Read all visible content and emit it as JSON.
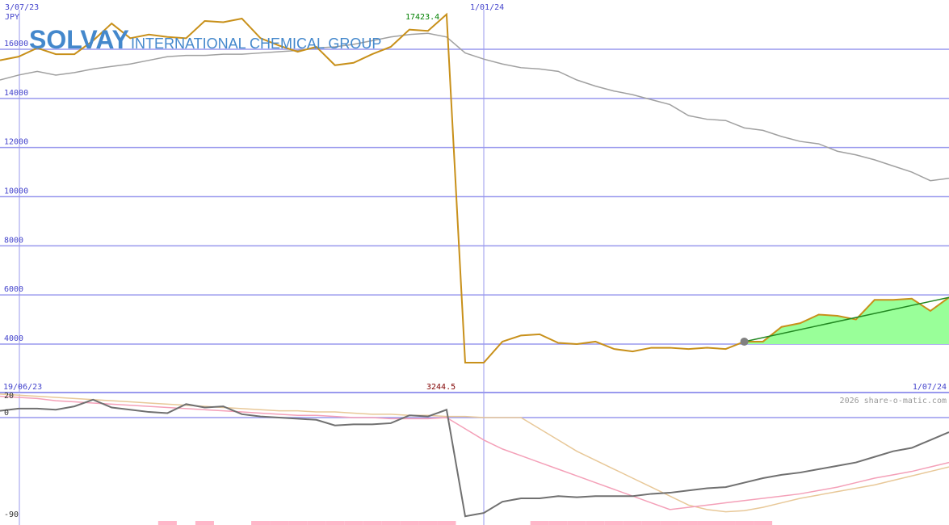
{
  "title": {
    "brand": "SOLVAY",
    "subtitle": "INTERNATIONAL CHEMICAL GROUP"
  },
  "copyright": "2026 share-o-matic.com",
  "colors": {
    "price": "#c8901a",
    "moving_avg": "#a0a0a0",
    "grid": "#9999ee",
    "axis_text": "#4444cc",
    "trend": "#228822",
    "trend_fill": "#99ff99",
    "marker": "#808080",
    "high_label": "#008000",
    "low_label": "#800000",
    "osc_main": "#707070",
    "osc_pink": "#f4a0b8",
    "osc_tan": "#e8c898",
    "volume": "#ffb6c8",
    "brand": "#4488cc"
  },
  "chart_data": [
    {
      "type": "line",
      "name": "price-panel",
      "unit_label": "JPY",
      "date_labels": [
        "3/07/23",
        "1/01/24"
      ],
      "ylim": [
        3000,
        17500
      ],
      "yticks": [
        4000,
        6000,
        8000,
        10000,
        12000,
        14000,
        16000
      ],
      "high_label": "17423.4",
      "low_label": "3244.5",
      "x": [
        0,
        1,
        2,
        3,
        4,
        5,
        6,
        7,
        8,
        9,
        10,
        11,
        12,
        13,
        14,
        15,
        16,
        17,
        18,
        19,
        20,
        21,
        22,
        23,
        24,
        25,
        26,
        27,
        28,
        29,
        30,
        31,
        32,
        33,
        34,
        35,
        36,
        37,
        38,
        39,
        40,
        41,
        42,
        43,
        44,
        45,
        46,
        47,
        48,
        49,
        50,
        51
      ],
      "series": [
        {
          "values": [
            15550,
            15700,
            16050,
            15800,
            15800,
            16350,
            17050,
            16450,
            16600,
            16500,
            16450,
            17150,
            17100,
            17250,
            16450,
            16150,
            15900,
            16100,
            15350,
            15450,
            15800,
            16100,
            16800,
            16750,
            17423,
            3244,
            3244,
            4100,
            4350,
            4400,
            4050,
            4000,
            4100,
            3800,
            3700,
            3850,
            3850,
            3800,
            3850,
            3800,
            4100,
            4100,
            4700,
            4850,
            5200,
            5150,
            5000,
            5800,
            5800,
            5850,
            5350,
            5900
          ]
        },
        {
          "values": [
            14750,
            14950,
            15100,
            14950,
            15050,
            15200,
            15300,
            15400,
            15550,
            15700,
            15750,
            15750,
            15800,
            15800,
            15850,
            15900,
            15950,
            16050,
            16100,
            16200,
            16350,
            16500,
            16600,
            16650,
            16500,
            15850,
            15600,
            15400,
            15250,
            15200,
            15100,
            14750,
            14500,
            14300,
            14150,
            13950,
            13750,
            13300,
            13150,
            13100,
            12800,
            12700,
            12450,
            12250,
            12150,
            11850,
            11700,
            11500,
            11250,
            11000,
            10650,
            10750
          ]
        }
      ],
      "trend": {
        "x": [
          40,
          51
        ],
        "y": [
          4100,
          5900
        ]
      }
    },
    {
      "type": "line",
      "name": "oscillator-panel",
      "date_labels": [
        "19/06/23",
        "1/07/24"
      ],
      "ylim": [
        -90,
        22
      ],
      "yticks": [
        20,
        0,
        -90
      ],
      "x": [
        0,
        1,
        2,
        3,
        4,
        5,
        6,
        7,
        8,
        9,
        10,
        11,
        12,
        13,
        14,
        15,
        16,
        17,
        18,
        19,
        20,
        21,
        22,
        23,
        24,
        25,
        26,
        27,
        28,
        29,
        30,
        31,
        32,
        33,
        34,
        35,
        36,
        37,
        38,
        39,
        40,
        41,
        42,
        43,
        44,
        45,
        46,
        47,
        48,
        49,
        50,
        51
      ],
      "series": [
        {
          "values": [
            6,
            8,
            8,
            7,
            10,
            16,
            9,
            7,
            5,
            4,
            12,
            9,
            10,
            3,
            1,
            0,
            -1,
            -2,
            -7,
            -6,
            -6,
            -5,
            2,
            1,
            7,
            -88,
            -85,
            -75,
            -72,
            -72,
            -70,
            -71,
            -70,
            -70,
            -70,
            -68,
            -67,
            -65,
            -63,
            -62,
            -58,
            -54,
            -51,
            -49,
            -46,
            -43,
            -40,
            -35,
            -30,
            -27,
            -20,
            -13
          ]
        },
        {
          "values": [
            19,
            18,
            17,
            15,
            14,
            13,
            12,
            11,
            10,
            9,
            8,
            7,
            6,
            5,
            4,
            3,
            2,
            2,
            1,
            0,
            0,
            -1,
            -1,
            -1,
            0,
            -10,
            -20,
            -28,
            -34,
            -40,
            -46,
            -52,
            -58,
            -64,
            -70,
            -76,
            -82,
            -80,
            -78,
            -76,
            -74,
            -72,
            -70,
            -68,
            -65,
            -62,
            -58,
            -54,
            -51,
            -48,
            -44,
            -40
          ]
        },
        {
          "values": [
            21,
            20,
            19,
            18,
            17,
            16,
            15,
            14,
            13,
            12,
            11,
            10,
            9,
            8,
            7,
            6,
            6,
            5,
            5,
            4,
            3,
            3,
            2,
            2,
            1,
            1,
            0,
            0,
            0,
            -10,
            -20,
            -30,
            -38,
            -46,
            -54,
            -62,
            -70,
            -78,
            -82,
            -84,
            -83,
            -80,
            -76,
            -72,
            -69,
            -66,
            -63,
            -60,
            -56,
            -52,
            -48,
            -44
          ]
        }
      ],
      "volume": [
        0,
        0,
        0,
        0,
        0,
        0,
        0,
        0,
        0,
        1,
        0,
        1,
        0,
        0,
        1,
        1,
        1,
        1,
        1,
        1,
        1,
        1,
        1,
        1,
        1,
        0,
        0,
        0,
        0,
        1,
        1,
        1,
        1,
        1,
        1,
        1,
        1,
        1,
        1,
        1,
        1,
        1,
        0,
        0,
        0,
        0,
        0,
        0,
        0,
        0,
        0,
        0
      ]
    }
  ]
}
